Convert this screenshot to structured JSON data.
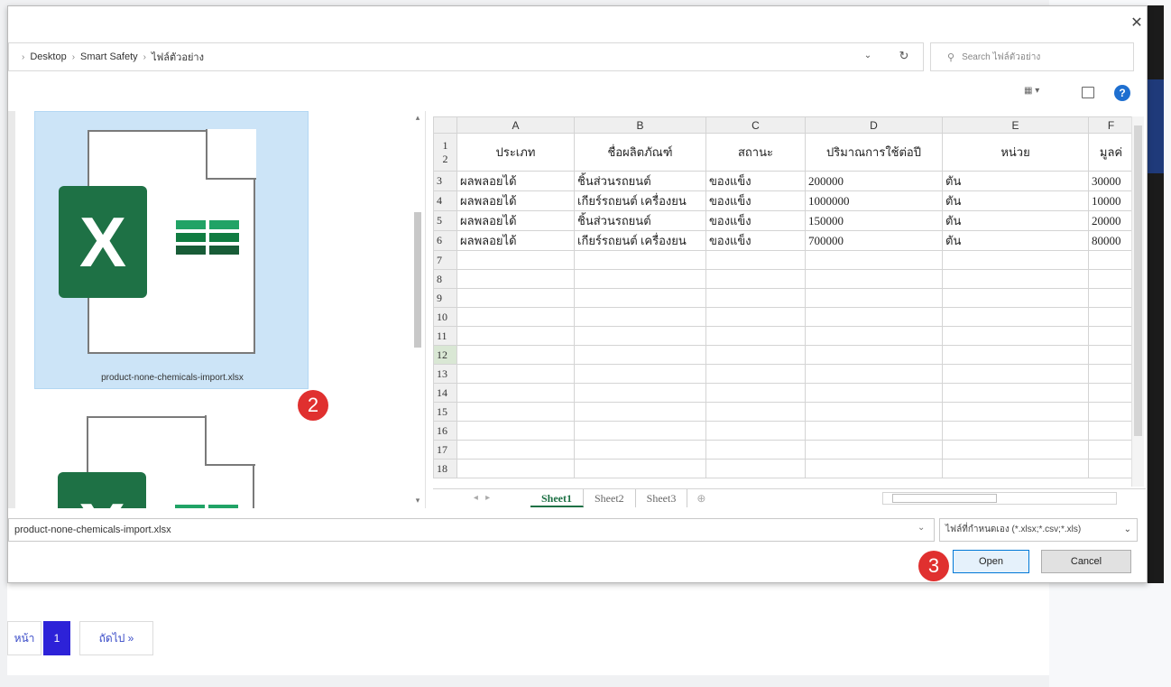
{
  "breadcrumb": {
    "items": [
      "Desktop",
      "Smart Safety",
      "ไฟล์ตัวอย่าง"
    ]
  },
  "search": {
    "placeholder": "Search ไฟล์ตัวอย่าง"
  },
  "files": [
    {
      "name": "product-none-chemicals-import.xlsx",
      "selected": true
    },
    {
      "name": ""
    }
  ],
  "badges": {
    "step2": "2",
    "step3": "3"
  },
  "spreadsheet": {
    "columns": [
      "A",
      "B",
      "C",
      "D",
      "E",
      "F"
    ],
    "headers": [
      "ประเภท",
      "ชื่อผลิตภัณฑ์",
      "สถานะ",
      "ปริมาณการใช้ต่อปี",
      "หน่วย",
      "มูลค่"
    ],
    "rows": [
      [
        "3",
        "ผลพลอยได้",
        "ชิ้นส่วนรถยนต์",
        "ของแข็ง",
        "200000",
        "ตัน",
        "30000"
      ],
      [
        "4",
        "ผลพลอยได้",
        "เกียร์รถยนต์ เครื่องยน",
        "ของแข็ง",
        "1000000",
        "ตัน",
        "10000"
      ],
      [
        "5",
        "ผลพลอยได้",
        "ชิ้นส่วนรถยนต์",
        "ของแข็ง",
        "150000",
        "ตัน",
        "20000"
      ],
      [
        "6",
        "ผลพลอยได้",
        "เกียร์รถยนต์ เครื่องยน",
        "ของแข็ง",
        "700000",
        "ตัน",
        "80000"
      ]
    ],
    "empty_rows": [
      "7",
      "8",
      "9",
      "10",
      "11",
      "12",
      "13",
      "14",
      "15",
      "16",
      "17",
      "18"
    ],
    "header_row_nums": [
      "1",
      "2"
    ],
    "tabs": [
      "Sheet1",
      "Sheet2",
      "Sheet3"
    ]
  },
  "bottom": {
    "filename_value": "product-none-chemicals-import.xlsx",
    "filetype_value": "ไฟล์ที่กำหนดเอง (*.xlsx;*.csv;*.xls)",
    "open_label": "Open",
    "cancel_label": "Cancel"
  },
  "pagination": {
    "prev": "หน้า",
    "current": "1",
    "next": "ถัดไป »"
  },
  "colors": {
    "excel_green": "#1e7145",
    "selection_blue": "#cce4f7",
    "badge_red": "#e0302f",
    "page_active": "#2d22d8"
  }
}
